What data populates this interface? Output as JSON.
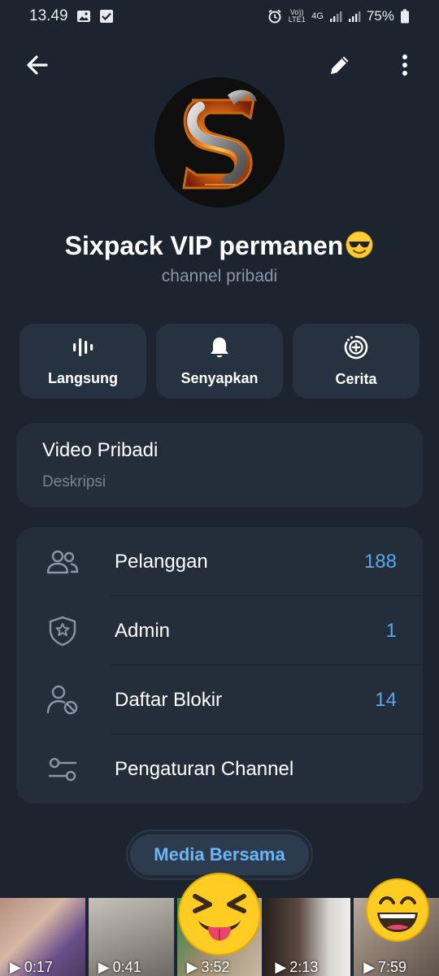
{
  "status_bar": {
    "time": "13.49",
    "volte": "Vo)) LTE1",
    "network": "4G",
    "battery": "75%"
  },
  "header": {
    "back_icon": "arrow-left-icon",
    "edit_icon": "pencil-icon",
    "more_icon": "more-vertical-icon"
  },
  "channel": {
    "name": "Sixpack VIP permanen",
    "name_emoji": "😎",
    "subtitle": "channel pribadi",
    "avatar_letter": "S"
  },
  "actions": [
    {
      "label": "Langsung",
      "icon": "live-stream-icon"
    },
    {
      "label": "Senyapkan",
      "icon": "bell-icon"
    },
    {
      "label": "Cerita",
      "icon": "story-add-icon"
    }
  ],
  "description_card": {
    "title": "Video Pribadi",
    "subtitle": "Deskripsi"
  },
  "list": [
    {
      "label": "Pelanggan",
      "count": "188",
      "icon": "users-icon"
    },
    {
      "label": "Admin",
      "count": "1",
      "icon": "shield-star-icon"
    },
    {
      "label": "Daftar Blokir",
      "count": "14",
      "icon": "user-block-icon"
    },
    {
      "label": "Pengaturan Channel",
      "count": "",
      "icon": "sliders-icon"
    }
  ],
  "media": {
    "chip_label": "Media Bersama",
    "thumbs": [
      {
        "duration": "0:17"
      },
      {
        "duration": "0:41"
      },
      {
        "duration": "3:52"
      },
      {
        "duration": "2:13"
      },
      {
        "duration": "7:59"
      }
    ]
  },
  "colors": {
    "background": "#1c2430",
    "card": "#242e3a",
    "accent": "#5aa8e8",
    "muted": "#8896a6"
  }
}
